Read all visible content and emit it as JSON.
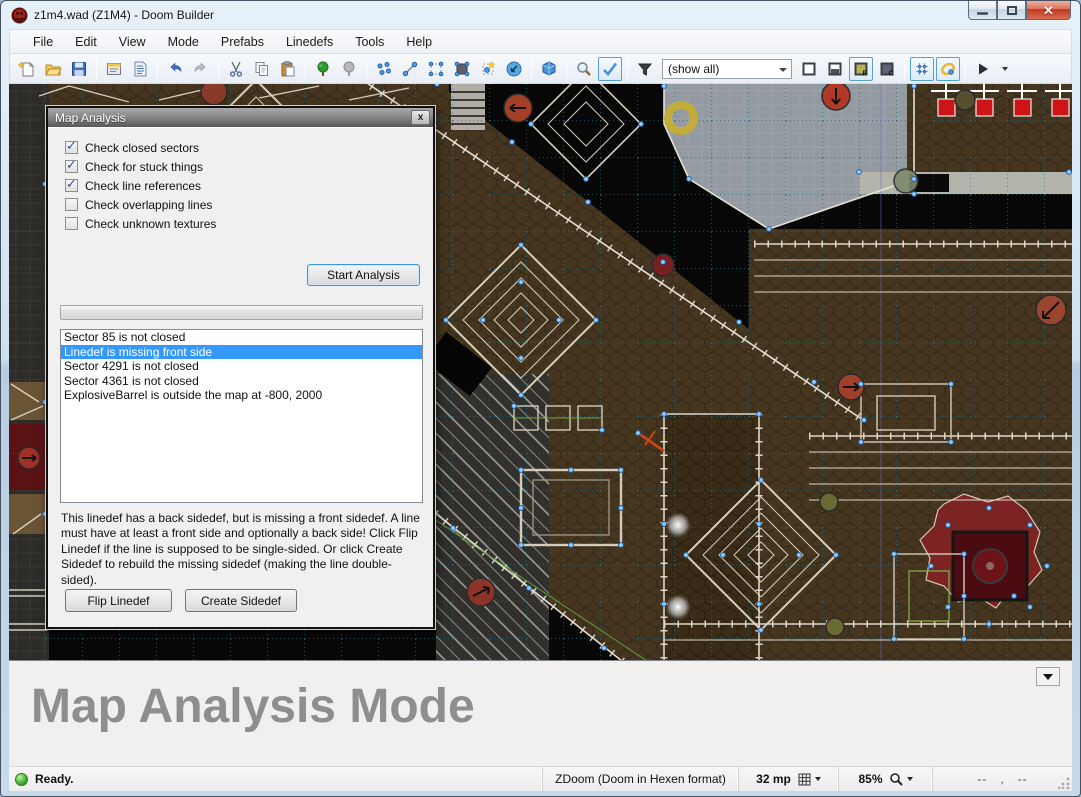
{
  "window": {
    "title": "z1m4.wad (Z1M4) - Doom Builder"
  },
  "menu": {
    "items": [
      "File",
      "Edit",
      "View",
      "Mode",
      "Prefabs",
      "Linedefs",
      "Tools",
      "Help"
    ]
  },
  "toolbar": {
    "filter_value": "(show all)"
  },
  "dialog": {
    "title": "Map Analysis",
    "close_label": "x",
    "checks": [
      {
        "label": "Check closed sectors",
        "checked": true
      },
      {
        "label": "Check for stuck things",
        "checked": true
      },
      {
        "label": "Check line references",
        "checked": true
      },
      {
        "label": "Check overlapping lines",
        "checked": false
      },
      {
        "label": "Check unknown textures",
        "checked": false
      }
    ],
    "start_button": "Start Analysis",
    "results": [
      "Sector 85 is not closed",
      "Linedef is missing front side",
      "Sector 4291 is not closed",
      "Sector 4361 is not closed",
      "ExplosiveBarrel is outside the map at -800, 2000"
    ],
    "selected_index": 1,
    "description": "This linedef has a back sidedef, but is missing a front sidedef. A line must have at least a front side and optionally a back side! Click Flip Linedef if the line is supposed to be single-sided. Or click Create Sidedef to rebuild the missing sidedef (making the line double-sided).",
    "flip_button": "Flip Linedef",
    "create_button": "Create Sidedef"
  },
  "banner": {
    "text": "Map Analysis Mode"
  },
  "statusbar": {
    "ready": "Ready.",
    "format": "ZDoom (Doom in Hexen format)",
    "grid_size": "32 mp",
    "zoom": "85%",
    "coord_x": "--",
    "coord_sep": ",",
    "coord_y": "--"
  },
  "colors": {
    "selection": "#3399ff",
    "focus_ring": "#3c97d8",
    "error_line": "#cc4418"
  }
}
